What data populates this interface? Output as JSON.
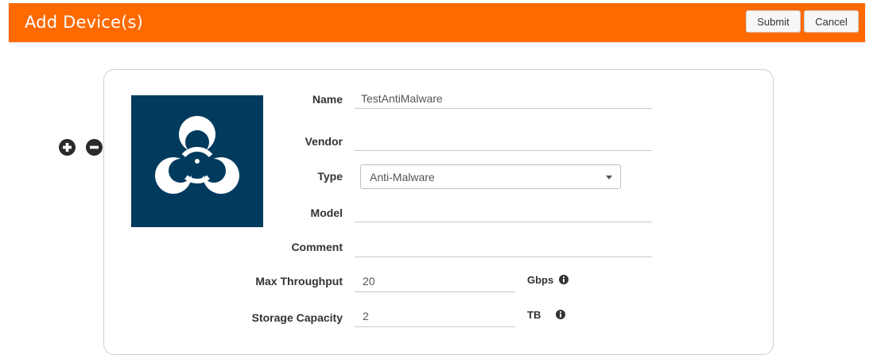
{
  "header": {
    "title": "Add Device(s)",
    "submit_label": "Submit",
    "cancel_label": "Cancel",
    "color": "#ff6a00"
  },
  "device": {
    "icon": "biohazard-icon",
    "tile_color": "#003a5d"
  },
  "controls": {
    "add_icon": "plus-circle-icon",
    "remove_icon": "minus-circle-icon"
  },
  "form": {
    "name": {
      "label": "Name",
      "value": "TestAntiMalware"
    },
    "vendor": {
      "label": "Vendor",
      "value": ""
    },
    "type": {
      "label": "Type",
      "value": "Anti-Malware"
    },
    "model": {
      "label": "Model",
      "value": ""
    },
    "comment": {
      "label": "Comment",
      "value": ""
    },
    "max_throughput": {
      "label": "Max Throughput",
      "value": "20",
      "unit": "Gbps"
    },
    "storage_capacity": {
      "label": "Storage Capacity",
      "value": "2",
      "unit": "TB"
    }
  }
}
